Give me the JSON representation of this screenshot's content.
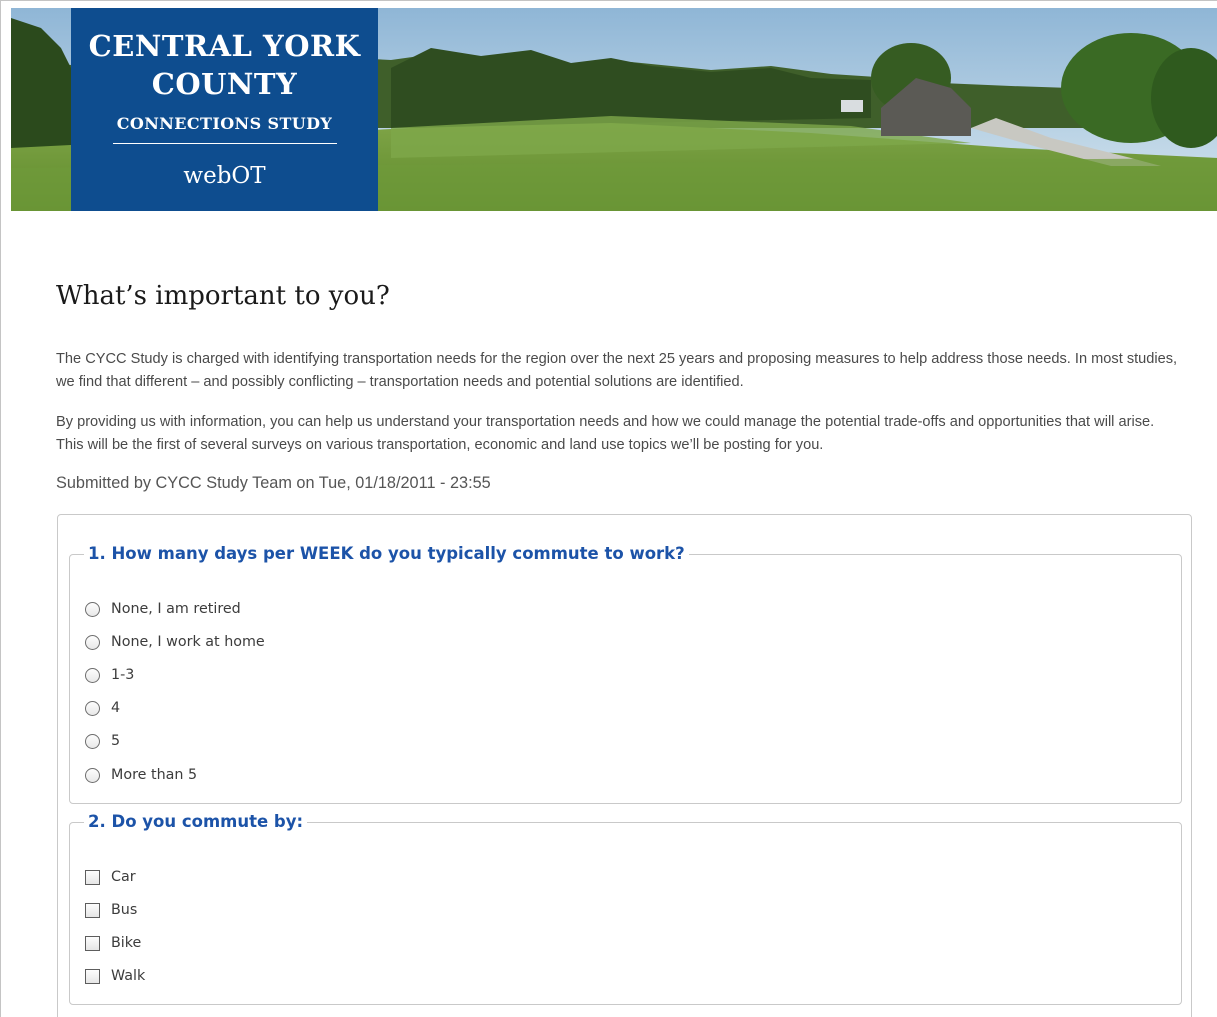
{
  "header": {
    "logo_line1": "CENTRAL YORK",
    "logo_line2": "COUNTY",
    "logo_line3": "CONNECTIONS STUDY",
    "logo_line4": "webOT",
    "logo_bg_color": "#0e4d8f"
  },
  "main": {
    "title": "What’s important to you?",
    "paragraph1": "The CYCC Study is charged with identifying transportation needs for the region over the next 25 years and proposing measures to help address those needs. In most studies, we find that different – and possibly conflicting – transportation needs and potential solutions are identified.",
    "paragraph2": "By providing us with information, you can help us understand your transportation needs and how we could manage the potential trade-offs and opportunities that will arise. This will be the first of several surveys on various transportation, economic and land use topics we’ll be posting for you.",
    "submitted": "Submitted by CYCC Study Team on Tue, 01/18/2011 - 23:55"
  },
  "survey": {
    "question_color": "#1c53a8",
    "q1": {
      "legend": "1. How many days per WEEK do you typically commute to work?",
      "input_type": "radio",
      "options": [
        "None, I am retired",
        "None, I work at home",
        "1-3",
        "4",
        "5",
        "More than 5"
      ]
    },
    "q2": {
      "legend": "2. Do you commute by:",
      "input_type": "checkbox",
      "options": [
        "Car",
        "Bus",
        "Bike",
        "Walk"
      ]
    }
  }
}
